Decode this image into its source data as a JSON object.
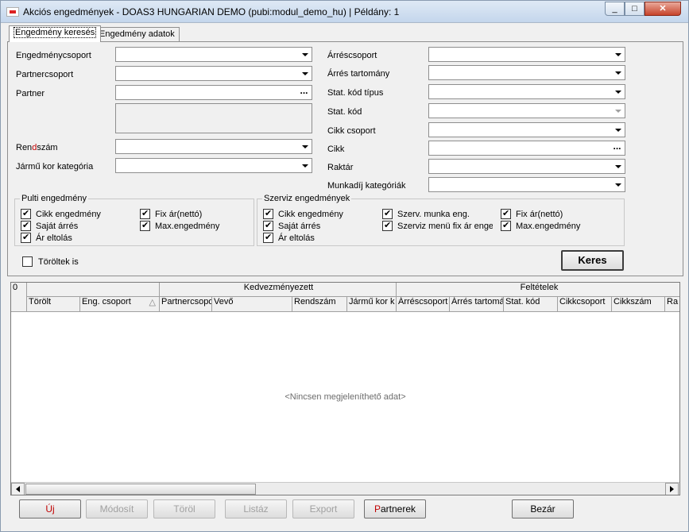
{
  "window": {
    "title": "Akciós engedmények - DOAS3 HUNGARIAN DEMO (pubi:modul_demo_hu) | Példány: 1",
    "min": "_",
    "max": "□",
    "close": "✕"
  },
  "tabs": [
    {
      "label": "Engedmény keresés"
    },
    {
      "label": "Engedmény adatok"
    }
  ],
  "form": {
    "left": {
      "engedmenycsoport": "Engedménycsoport",
      "partnercsoport": "Partnercsoport",
      "partner": "Partner",
      "rendszam": "Rendszám",
      "jarmu_kor": "Jármű kor kategória"
    },
    "right": {
      "arrescsoport": "Árréscsoport",
      "arres_tartomany": "Árrés tartomány",
      "stat_kod_tipus": "Stat. kód típus",
      "stat_kod": "Stat. kód",
      "cikk_csoport": "Cikk csoport",
      "cikk": "Cikk",
      "raktar": "Raktár",
      "munkadij": "Munkadíj kategóriák"
    },
    "ellipsis": "..."
  },
  "pulti": {
    "title": "Pulti engedmény",
    "items": [
      "Cikk engedmény",
      "Saját árrés",
      "Ár eltolás",
      "Fix ár(nettó)",
      "Max.engedmény"
    ]
  },
  "szerviz": {
    "title": "Szerviz  engedmények",
    "items": [
      "Cikk engedmény",
      "Saját árrés",
      "Ár eltolás",
      "Szerv. munka eng.",
      "Szerviz menü fix ár engec",
      "Fix ár(nettó)",
      "Max.engedmény"
    ]
  },
  "toroltek": "Töröltek is",
  "keres": "Keres",
  "grid": {
    "corner": "0",
    "group1": "Kedvezményezett",
    "group2": "Feltételek",
    "cols": [
      "Törölt",
      "Eng. csoport",
      "Partnercsopo",
      "Vevő",
      "Rendszám",
      "Jármű kor k",
      "Árréscsoport",
      "Árrés tartomá",
      "Stat. kód",
      "Cikkcsoport",
      "Cikkszám",
      "Ra"
    ],
    "sort_icon": "△",
    "empty": "<Nincsen megjeleníthető adat>"
  },
  "buttons": {
    "uj": "Új",
    "modosit": "Módosít",
    "torol": "Töröl",
    "listaz": "Listáz",
    "export": "Export",
    "partnerek": "Partnerek",
    "bezar": "Bezár"
  }
}
